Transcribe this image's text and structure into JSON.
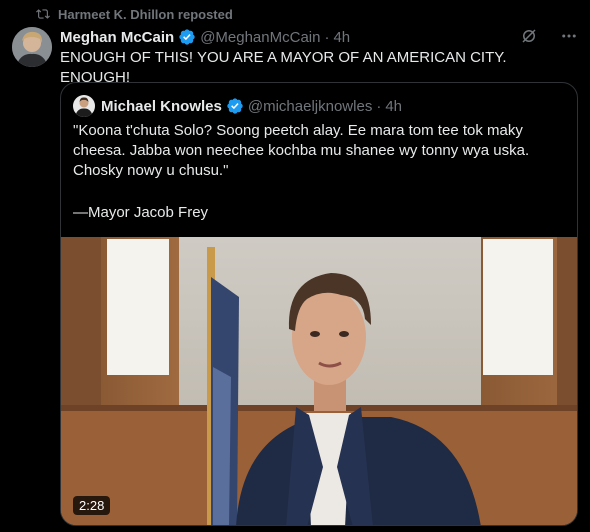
{
  "repost": {
    "text": "Harmeet K. Dhillon reposted"
  },
  "tweet": {
    "author_name": "Meghan McCain",
    "handle": "@MeghanMcCain",
    "separator": "·",
    "time": "4h",
    "text": "ENOUGH OF THIS! YOU ARE A MAYOR OF AN AMERICAN CITY. ENOUGH!"
  },
  "quote": {
    "author_name": "Michael Knowles",
    "handle": "@michaeljknowles",
    "separator": "·",
    "time": "4h",
    "text": "\"Koona t'chuta Solo? Soong peetch alay. Ee mara tom tee tok maky cheesa. Jabba won neechee kochba mu shanee wy tonny wya uska. Chosky nowy u chusu.\"",
    "signature": "—Mayor Jacob Frey",
    "video_duration": "2:28"
  },
  "colors": {
    "verified": "#1d9bf0",
    "muted": "#71767b",
    "text": "#e7e9ea",
    "border": "#2f3336"
  },
  "icons": [
    "repost-icon",
    "verified-icon",
    "grok-icon",
    "more-icon",
    "play-video"
  ]
}
